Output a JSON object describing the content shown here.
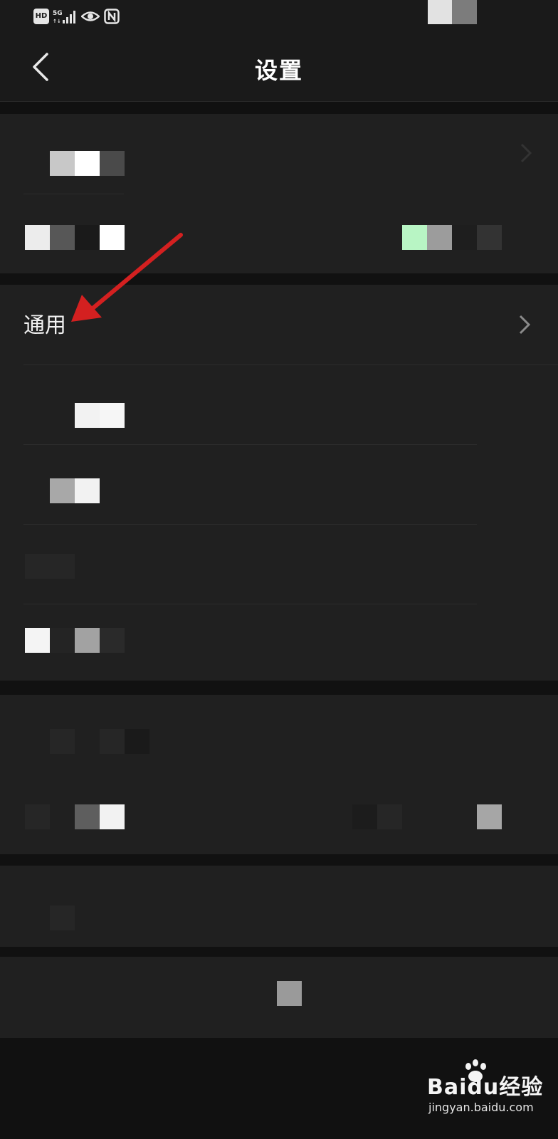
{
  "status_bar": {
    "hd_label": "HD",
    "network_label": "5G",
    "icons": [
      "hd-icon",
      "signal-5g-icon",
      "eye-icon",
      "nfc-icon"
    ]
  },
  "header": {
    "title": "设置",
    "back_icon": "chevron-left-icon"
  },
  "general_row": {
    "label": "通用",
    "chevron_icon": "chevron-right-icon"
  },
  "annotation": {
    "color": "#d42020",
    "icon": "red-arrow-icon"
  },
  "watermark": {
    "brand": "Bai\u0000经验",
    "brand_text": "Baidu经验",
    "site": "jingyan.baidu.com"
  },
  "colors": {
    "background": "#111111",
    "panel": "#202020",
    "header": "#1a1a1a",
    "text": "#ffffff",
    "chevron": "#8a8a8a"
  }
}
